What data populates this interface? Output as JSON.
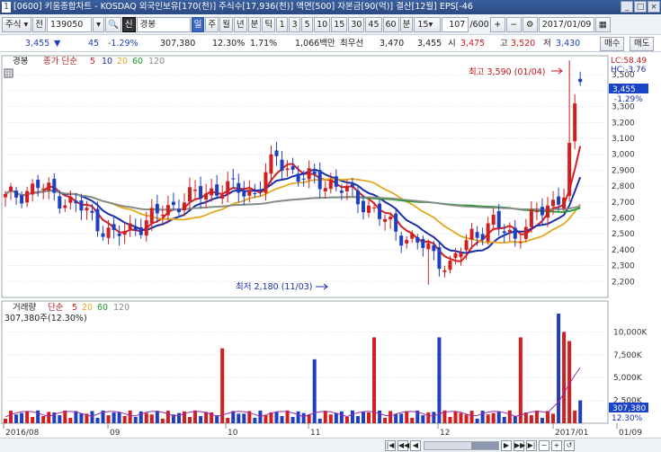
{
  "window": {
    "code": "1",
    "title": "[0600] 키움종합차트 - KOSDAQ 외국인보유[170(천)] 주식수[17,936(천)] 액면[500] 자본금[90(억)] 결산[12월] EPS[-46"
  },
  "toolbar": {
    "market": "주식",
    "prev": "전",
    "code": "139050",
    "search_prefix": "신",
    "stock_name": "경봉",
    "periods": [
      "일",
      "주",
      "월",
      "년",
      "분",
      "틱"
    ],
    "selected_period": "일",
    "intervals": [
      "1",
      "3",
      "5",
      "10",
      "15",
      "30",
      "45",
      "60",
      "분"
    ],
    "interval_select": "15",
    "count": "107",
    "total": "/600",
    "date": "2017/01/09"
  },
  "infobar": {
    "price": "3,455",
    "arrow": "▼",
    "change": "45",
    "change_pct": "-1.29%",
    "volume": "307,380",
    "vol_ratio": "12.30%",
    "turnover": "1.71%",
    "amount": "1,066백만",
    "best_ask_label": "최우선",
    "best_ask": "3,470",
    "best_bid": "3,455",
    "open_label": "시",
    "open": "3,475",
    "high_label": "고",
    "high": "3,520",
    "low_label": "저",
    "low": "3,430",
    "buy_button": "매수",
    "sell_button": "매도"
  },
  "price_panel": {
    "name": "경봉",
    "ma_label": "종가 단순",
    "ma_periods": [
      "5",
      "10",
      "20",
      "60",
      "120"
    ],
    "ma_colors": [
      "#d42020",
      "#1a2fa8",
      "#e3a81e",
      "#1e9a2a",
      "#8a8a8a"
    ],
    "lc": "LC:58.49",
    "hc": "HC:-3.76",
    "current": "3,455",
    "current_pct": "-1.29%",
    "high_annotation": "최고 3,590 (01/04)",
    "low_annotation": "최저 2,180 (11/03)",
    "y_ticks": [
      "3,500",
      "3,400",
      "3,300",
      "3,200",
      "3,100",
      "3,000",
      "2,900",
      "2,800",
      "2,700",
      "2,600",
      "2,500",
      "2,400",
      "2,300",
      "2,200"
    ]
  },
  "volume_panel": {
    "name": "거래량",
    "ma_label": "단순",
    "ma_periods": [
      "5",
      "20",
      "60",
      "120"
    ],
    "current": "307,380주(12.30%)",
    "y_ticks": [
      "10,000K",
      "7,500K",
      "5,000K",
      "2,500K"
    ],
    "badge_value": "307,380",
    "badge_pct": "12.30%"
  },
  "x_axis": {
    "labels": [
      "2016/08",
      "09",
      "10",
      "11",
      "12",
      "2017/01",
      "01/09"
    ]
  },
  "chart_data": {
    "type": "candlestick",
    "title": "경봉",
    "xlabel": "",
    "ylabel": "",
    "ylim": [
      2100,
      3620
    ],
    "high": {
      "value": 3590,
      "date": "01/04"
    },
    "low": {
      "value": 2180,
      "date": "11/03"
    },
    "last_close": 3455,
    "series": [
      {
        "name": "경봉",
        "note": "daily OHLC, 107 bars"
      }
    ]
  }
}
